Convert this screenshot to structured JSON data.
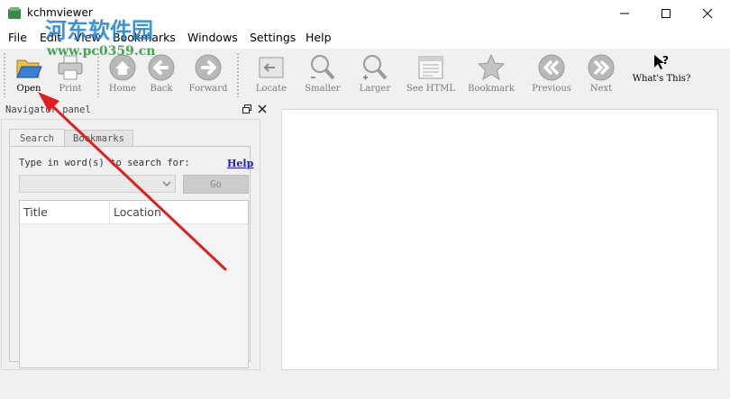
{
  "window": {
    "title": "kchmviewer"
  },
  "menu": [
    "File",
    "Edit",
    "View",
    "Bookmarks",
    "Windows",
    "Settings",
    "Help"
  ],
  "toolbar": {
    "open": "Open",
    "print": "Print",
    "home": "Home",
    "back": "Back",
    "forward": "Forward",
    "locate": "Locate",
    "smaller": "Smaller",
    "larger": "Larger",
    "see_html": "See HTML",
    "bookmark": "Bookmark",
    "previous": "Previous",
    "next": "Next",
    "whats_this": "What's This?"
  },
  "navigator": {
    "title": "Navigator panel",
    "tabs": [
      "Search",
      "Bookmarks"
    ],
    "search_prompt": "Type in word(s) to search for:",
    "help_link": "Help",
    "search_value": "",
    "go_label": "Go",
    "columns": [
      "Title",
      "Location"
    ]
  },
  "watermark": {
    "line1": "河东软件园",
    "line2": "www.pc0359.cn"
  },
  "colors": {
    "accent": "#1a1ad6",
    "annotation_arrow": "#e02020",
    "watermark": "#1a7fd0"
  }
}
